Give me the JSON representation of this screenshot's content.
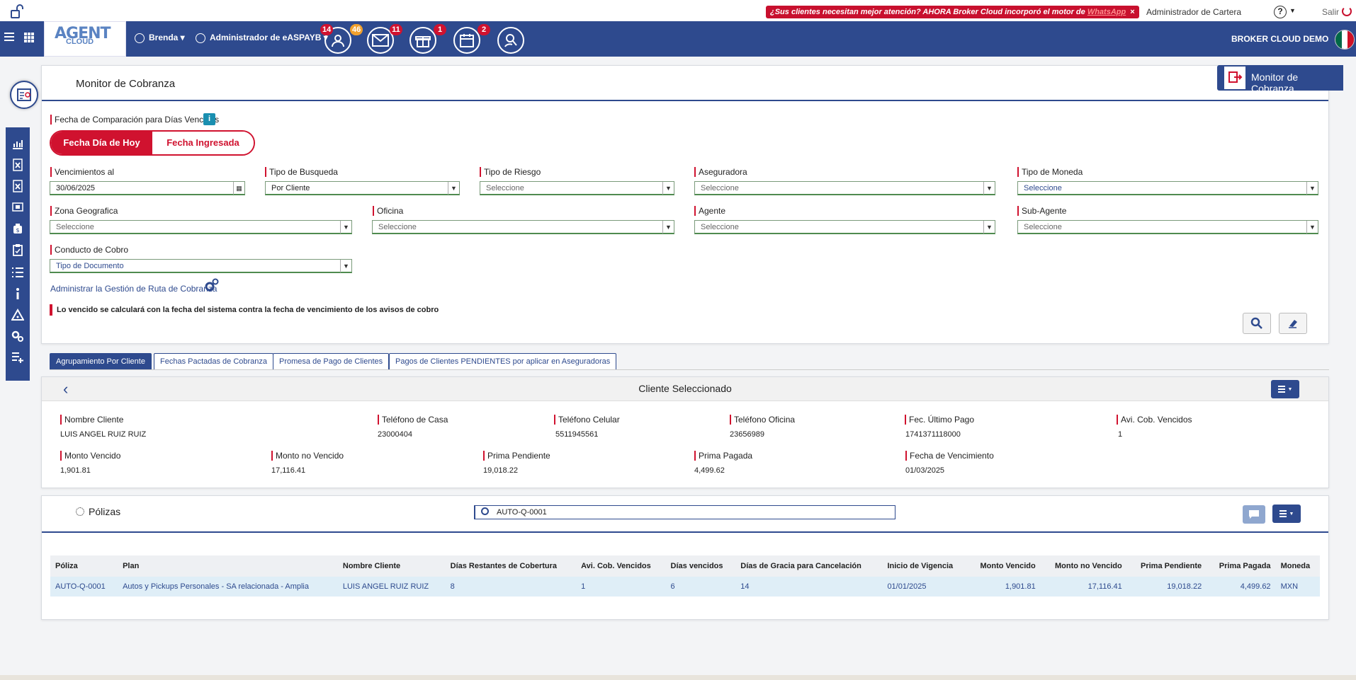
{
  "topbar": {
    "promo_text": "¿Sus clientes necesitan mejor atención? AHORA Broker Cloud incorporó el motor de ",
    "promo_highlight": "WhatsApp",
    "promo_close": "×",
    "role_link": "Administrador de Cartera",
    "help": "?",
    "logout": "Salir"
  },
  "navbar": {
    "logo_main": "AGENT",
    "logo_sub": "CLOUD",
    "user_name": "Brenda",
    "profile": "Administrador de eASPAYB",
    "badges": {
      "clients": "14",
      "clients_alt": "46",
      "messages": "11",
      "gifts": "1",
      "calendar": "2"
    },
    "company": "BROKER CLOUD DEMO"
  },
  "monitor": {
    "title": "Monitor de Cobranza",
    "tab_label": "Monitor de Cobranza",
    "compare_label": "Fecha de Comparación para Días Vencidos",
    "info": "i",
    "toggle_today": "Fecha Día de Hoy",
    "toggle_entered": "Fecha Ingresada",
    "fields": {
      "due_label": "Vencimientos al",
      "due_value": "30/06/2025",
      "search_type_label": "Tipo de Busqueda",
      "search_type_value": "Por Cliente",
      "risk_label": "Tipo de Riesgo",
      "risk_value": "Seleccione",
      "insurer_label": "Aseguradora",
      "insurer_value": "Seleccione",
      "currency_label": "Tipo de Moneda",
      "currency_value": "Seleccione",
      "zone_label": "Zona Geografica",
      "zone_value": "Seleccione",
      "office_label": "Oficina",
      "office_value": "Seleccione",
      "agent_label": "Agente",
      "agent_value": "Seleccione",
      "subagent_label": "Sub-Agente",
      "subagent_value": "Seleccione",
      "channel_label": "Conducto de Cobro",
      "channel_value": "Tipo de Documento"
    },
    "route_link": "Administrar la Gestión de Ruta de Cobranza",
    "note": "Lo vencido se calculará con la fecha del sistema contra la fecha de vencimiento de los avisos de cobro"
  },
  "tabs": [
    "Agrupamiento Por Cliente",
    "Fechas Pactadas de Cobranza",
    "Promesa de Pago de Clientes",
    "Pagos de Clientes PENDIENTES por aplicar en Aseguradoras"
  ],
  "client": {
    "title": "Cliente Seleccionado",
    "name_label": "Nombre Cliente",
    "name": "LUIS ANGEL RUIZ RUIZ",
    "home_phone_label": "Teléfono de Casa",
    "home_phone": "23000404",
    "cell_phone_label": "Teléfono Celular",
    "cell_phone": "5511945561",
    "office_phone_label": "Teléfono Oficina",
    "office_phone": "23656989",
    "last_payment_label": "Fec. Último Pago",
    "last_payment": "1741371118000",
    "overdue_notices_label": "Avi. Cob. Vencidos",
    "overdue_notices": "1",
    "overdue_amount_label": "Monto Vencido",
    "overdue_amount": "1,901.81",
    "not_overdue_label": "Monto no Vencido",
    "not_overdue": "17,116.41",
    "pending_label": "Prima Pendiente",
    "pending": "19,018.22",
    "paid_label": "Prima Pagada",
    "paid": "4,499.62",
    "due_date_label": "Fecha de Vencimiento",
    "due_date": "01/03/2025"
  },
  "policies": {
    "title": "Pólizas",
    "search_value": "AUTO-Q-0001",
    "columns": [
      "Póliza",
      "Plan",
      "Nombre Cliente",
      "Días Restantes de Cobertura",
      "Avi. Cob. Vencidos",
      "Días vencidos",
      "Días de Gracia para Cancelación",
      "Inicio de Vigencia",
      "Monto Vencido",
      "Monto no Vencido",
      "Prima Pendiente",
      "Prima Pagada",
      "Moneda"
    ],
    "rows": [
      [
        "AUTO-Q-0001",
        "Autos y Pickups Personales - SA relacionada - Amplia",
        "LUIS ANGEL RUIZ RUIZ",
        "8",
        "1",
        "6",
        "14",
        "01/01/2025",
        "1,901.81",
        "17,116.41",
        "19,018.22",
        "4,499.62",
        "MXN"
      ]
    ]
  }
}
